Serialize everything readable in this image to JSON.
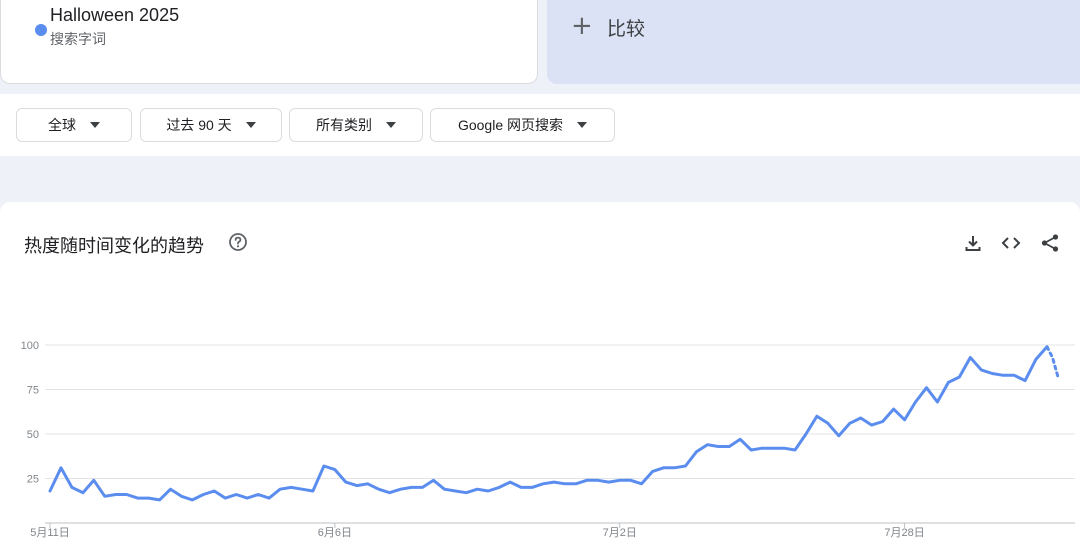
{
  "search_term": {
    "name": "Halloween 2025",
    "type": "搜索字词",
    "color": "#5b8def"
  },
  "compare": {
    "icon": "plus-icon",
    "label": "比较"
  },
  "filters": [
    {
      "label": "全球"
    },
    {
      "label": "过去 90 天"
    },
    {
      "label": "所有类别"
    },
    {
      "label": "Google 网页搜索"
    }
  ],
  "chart": {
    "title": "热度随时间变化的趋势",
    "help_icon": "help-circle-icon",
    "actions": [
      "download-icon",
      "embed-code-icon",
      "share-icon"
    ]
  },
  "chart_data": {
    "type": "line",
    "title": "",
    "xlabel": "",
    "ylabel": "",
    "ylim": [
      0,
      100
    ],
    "yticks": [
      25,
      50,
      75,
      100
    ],
    "grid": true,
    "x_tick_labels": [
      "5月11日",
      "6月6日",
      "7月2日",
      "7月28日"
    ],
    "x_tick_index": [
      0,
      26,
      52,
      78
    ],
    "series": [
      {
        "color": "#5b8def",
        "values": [
          18,
          31,
          20,
          17,
          24,
          15,
          16,
          16,
          14,
          14,
          13,
          19,
          15,
          13,
          16,
          18,
          14,
          16,
          14,
          16,
          14,
          19,
          20,
          19,
          18,
          32,
          30,
          23,
          21,
          22,
          19,
          17,
          19,
          20,
          20,
          24,
          19,
          18,
          17,
          19,
          18,
          20,
          23,
          20,
          20,
          22,
          23,
          22,
          22,
          24,
          24,
          23,
          24,
          24,
          22,
          29,
          31,
          31,
          32,
          40,
          44,
          43,
          43,
          47,
          41,
          42,
          42,
          42,
          41,
          50,
          60,
          56,
          49,
          56,
          59,
          55,
          57,
          64,
          58,
          68,
          76,
          68,
          79,
          82,
          93,
          86,
          84,
          83,
          83,
          80,
          92,
          99
        ],
        "partial_values": [
          99,
          93,
          82
        ]
      }
    ]
  }
}
